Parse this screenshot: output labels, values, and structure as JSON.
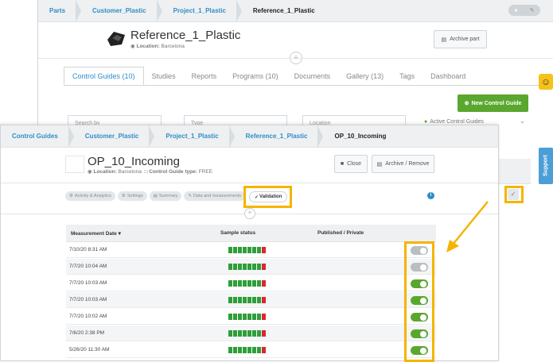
{
  "back": {
    "breadcrumb": [
      "Parts",
      "Customer_Plastic",
      "Project_1_Plastic",
      "Reference_1_Plastic"
    ],
    "title": "Reference_1_Plastic",
    "location_label": "Location:",
    "location": "Barcelona",
    "archive_label": "Archive part",
    "tabs": [
      "Control Guides (10)",
      "Studies",
      "Reports",
      "Programs (10)",
      "Documents",
      "Gallery (13)",
      "Tags",
      "Dashboard"
    ],
    "new_guide_label": "New Control Guide",
    "filters": {
      "search_placeholder": "Search by",
      "type": "Type",
      "location": "Location",
      "active_label": "Active Control Guides"
    }
  },
  "front": {
    "breadcrumb": [
      "Control Guides",
      "Customer_Plastic",
      "Project_1_Plastic",
      "Reference_1_Plastic",
      "OP_10_Incoming"
    ],
    "title": "OP_10_Incoming",
    "location_label": "Location:",
    "location": "Barcelona",
    "type_label": "Control Guide type:",
    "type": "FREE",
    "close_label": "Close",
    "archive_label": "Archive / Remove",
    "pills": [
      "Activity & Analytics",
      "Settings",
      "Summary",
      "Data and measurements"
    ],
    "validation_label": "Validation",
    "table": {
      "headers": [
        "Measurement Date",
        "Sample status",
        "Published / Private"
      ],
      "rows": [
        {
          "date": "7/10/20 8:31 AM",
          "published": false
        },
        {
          "date": "7/7/20 10:04 AM",
          "published": false
        },
        {
          "date": "7/7/20 10:03 AM",
          "published": true
        },
        {
          "date": "7/7/20 10:03 AM",
          "published": true
        },
        {
          "date": "7/7/20 10:02 AM",
          "published": true
        },
        {
          "date": "7/6/20 2:38 PM",
          "published": true
        },
        {
          "date": "5/26/20 11:30 AM",
          "published": true
        }
      ]
    }
  },
  "support_label": "Support",
  "colors": {
    "accent": "#2f8dc7",
    "green": "#5aa72f",
    "highlight": "#f5b400",
    "red": "#d9282f"
  }
}
